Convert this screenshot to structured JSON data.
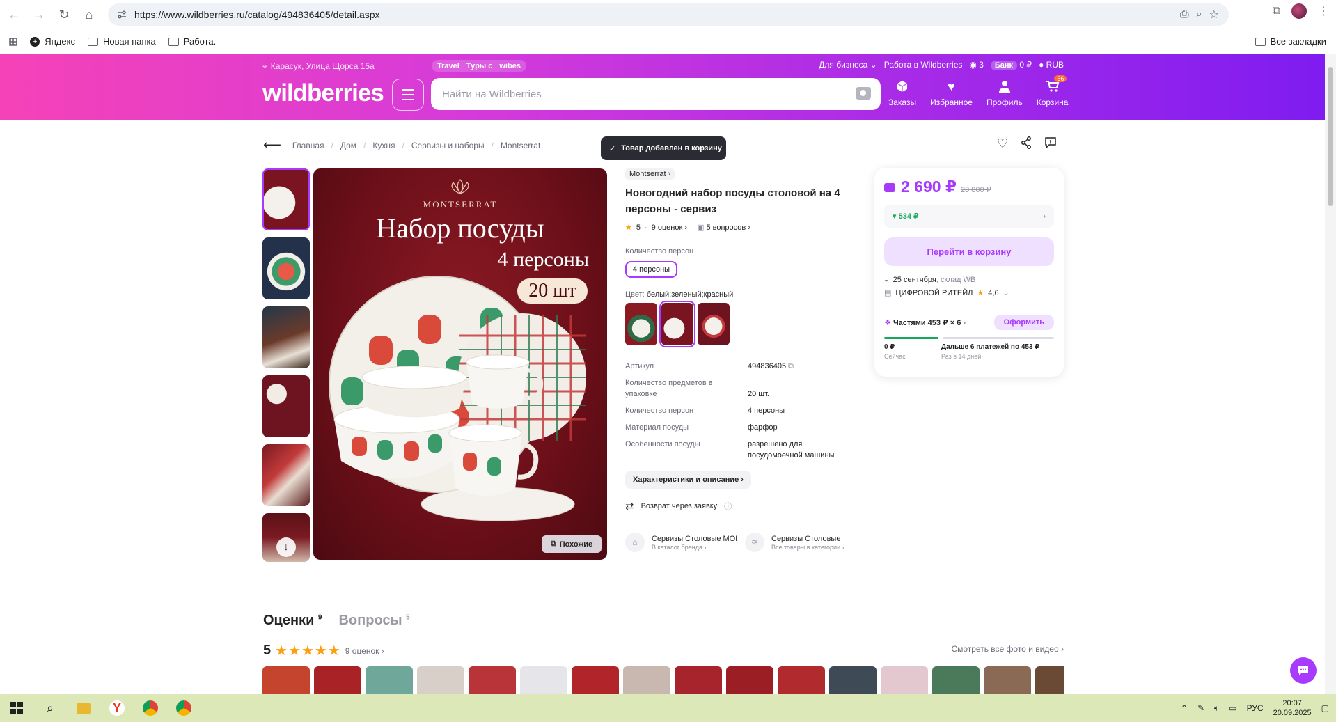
{
  "browser": {
    "url": "https://www.wildberries.ru/catalog/494836405/detail.aspx",
    "bookmarks": [
      "Яндекс",
      "Новая папка",
      "Работа."
    ],
    "all_bookmarks": "Все закладки"
  },
  "header": {
    "location": "Карасук, Улица Щорса 15а",
    "promos": [
      "Travel",
      "Туры с",
      "wibes"
    ],
    "business": "Для бизнеса",
    "jobs": "Работа в Wildberries",
    "points": "3",
    "bank_label": "Банк",
    "balance": "0 ₽",
    "currency": "RUB",
    "logo": "wildberries",
    "search_placeholder": "Найти на Wildberries",
    "actions": [
      {
        "label": "Заказы"
      },
      {
        "label": "Избранное"
      },
      {
        "label": "Профиль"
      },
      {
        "label": "Корзина",
        "badge": "56"
      }
    ]
  },
  "breadcrumbs": [
    "Главная",
    "Дом",
    "Кухня",
    "Сервизы и наборы",
    "Montserrat"
  ],
  "toast": "Товар добавлен в корзину",
  "image": {
    "brand": "MONTSERRAT",
    "title": "Набор посуды",
    "subtitle": "4 персоны",
    "count": "20 шт",
    "similar": "Похожие"
  },
  "product": {
    "brand": "Montserrat",
    "title": "Новогодний набор посуды столовой на 4 персоны - сервиз",
    "rating": "5",
    "reviews": "9 оценок",
    "questions": "5 вопросов",
    "persons_label": "Количество персон",
    "persons_value": "4 персоны",
    "color_label": "Цвет:",
    "color_value": "белый;зеленый;красный",
    "specs": [
      {
        "key": "Артикул",
        "value": "494836405"
      },
      {
        "key": "Количество предметов в упаковке",
        "value": "20 шт."
      },
      {
        "key": "Количество персон",
        "value": "4 персоны"
      },
      {
        "key": "Материал посуды",
        "value": "фарфор"
      },
      {
        "key": "Особенности посуды",
        "value": "разрешено для посудомоечной машины"
      }
    ],
    "desc_button": "Характеристики и описание",
    "return": "Возврат через заявку",
    "links": [
      {
        "title": "Сервизы Столовые MONTSERRAT",
        "sub": "В каталог бренда"
      },
      {
        "title": "Сервизы Столовые",
        "sub": "Все товары в категории"
      }
    ]
  },
  "price_card": {
    "price": "2 690 ₽",
    "old_price": "28 800 ₽",
    "wb_discount": "534 ₽",
    "cart_button": "Перейти в корзину",
    "delivery_date": "25 сентября",
    "delivery_place": ", склад WB",
    "seller": "ЦИФРОВОЙ РИТЕЙЛ",
    "seller_rating": "4,6",
    "installments": "Частями 453 ₽ × 6",
    "installments_button": "Оформить",
    "now_amount": "0 ₽",
    "now_label": "Сейчас",
    "later_text": "Дальше 6 платежей по 453 ₽",
    "later_label": "Раз в 14 дней"
  },
  "reviews": {
    "tab_reviews": "Оценки",
    "tab_reviews_count": "9",
    "tab_questions": "Вопросы",
    "tab_questions_count": "5",
    "rating": "5",
    "stars": "★★★★★",
    "count": "9 оценок",
    "see_all": "Смотреть все фото и видео"
  },
  "taskbar": {
    "lang": "РУС",
    "time": "20:07",
    "date": "20.09.2025"
  }
}
